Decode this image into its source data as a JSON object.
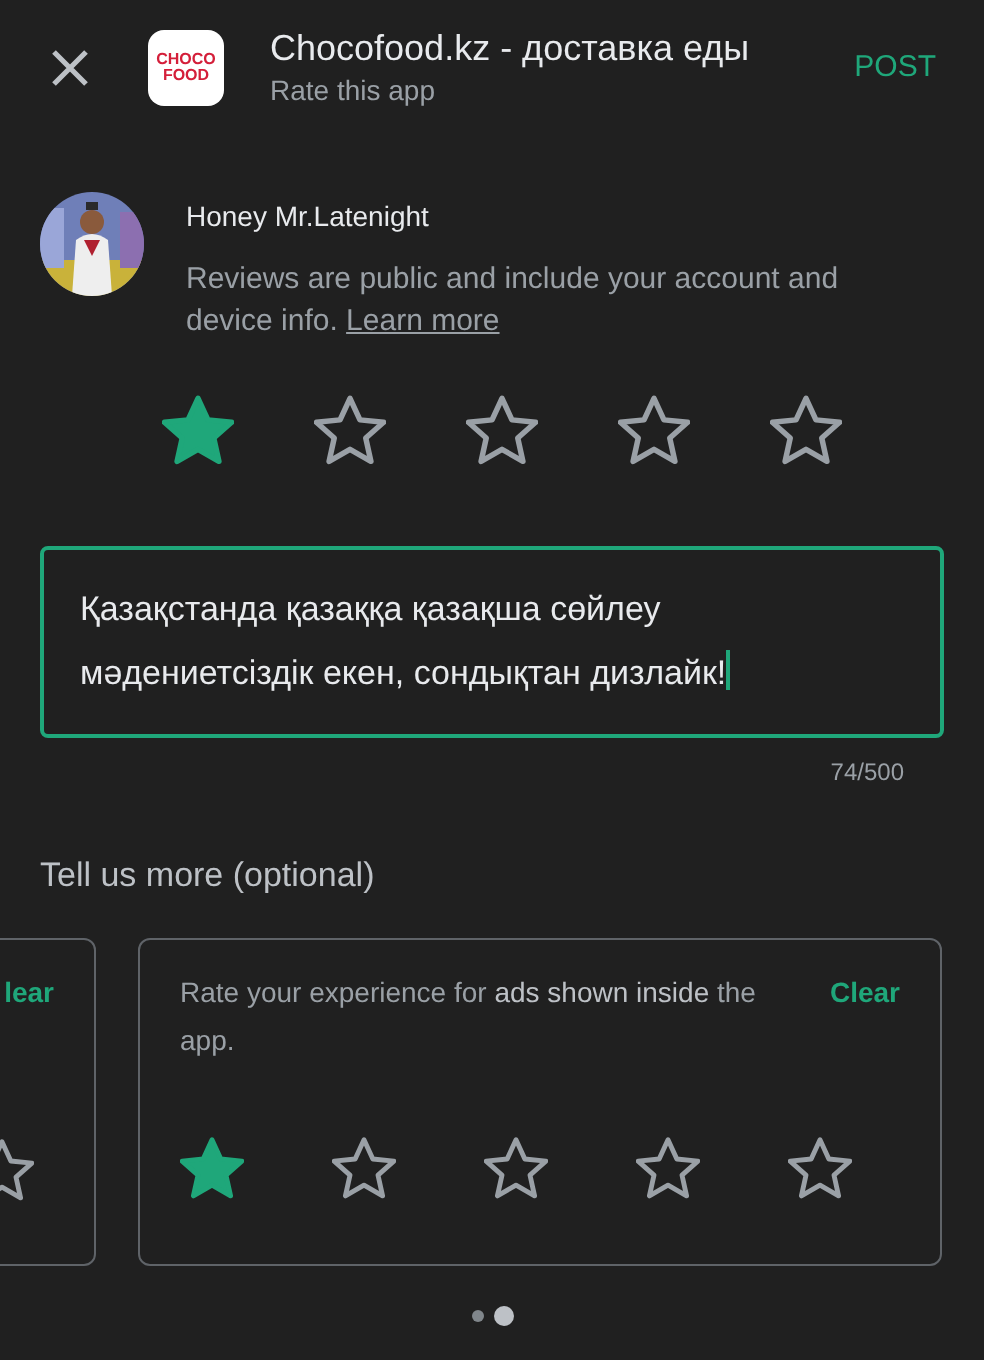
{
  "header": {
    "logo_text": [
      "CHOCO",
      "FOOD"
    ],
    "app_title": "Chocofood.kz - доставка еды",
    "subtitle": "Rate this app",
    "post_button": "POST"
  },
  "user": {
    "name": "Honey Mr.Latenight",
    "notice": "Reviews are public and include your account and device info.",
    "learn_more": "Learn more"
  },
  "rating": {
    "stars": 1
  },
  "review": {
    "value": "Қазақстанда қазаққа қазақша сөйлеу мәдениетсіздік екен, сондықтан дизлайк!",
    "focused": true,
    "counter": "74/500"
  },
  "more": {
    "title": "Tell us more (optional)",
    "cards": [
      {
        "clear": "lear"
      },
      {
        "question": "Rate your experience for **ads shown inside** the app.",
        "clear": "Clear",
        "stars": 1
      }
    ]
  },
  "pager": {
    "pages": [
      {
        "selected": false
      },
      {
        "selected": true
      }
    ]
  }
}
